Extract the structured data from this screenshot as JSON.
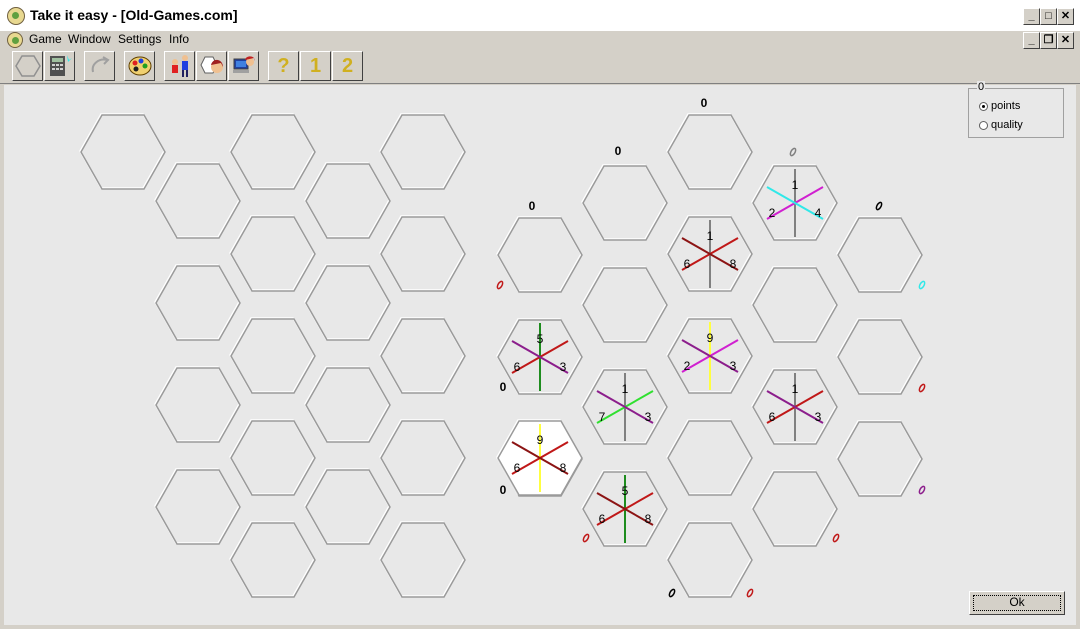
{
  "window": {
    "title": "Take it easy - [Old-Games.com]",
    "controls": [
      "_",
      "□",
      "✕"
    ],
    "mdi_controls": [
      "_",
      "❐",
      "✕"
    ]
  },
  "menu": {
    "items": [
      "Game",
      "Window",
      "Settings",
      "Info"
    ]
  },
  "toolbar": {
    "buttons": [
      {
        "name": "hexagon-button",
        "icon": "hexagon-icon",
        "enabled": false
      },
      {
        "name": "calculator-button",
        "icon": "calculator-icon",
        "enabled": true
      },
      {
        "name": "undo-button",
        "icon": "undo-arrow-icon",
        "enabled": false
      },
      {
        "name": "palette-button",
        "icon": "palette-icon",
        "enabled": true
      },
      {
        "name": "players-button",
        "icon": "players-icon",
        "enabled": true
      },
      {
        "name": "computer-player-button",
        "icon": "computer-player-icon",
        "enabled": true
      },
      {
        "name": "user-computer-button",
        "icon": "user-computer-icon",
        "enabled": true
      },
      {
        "name": "help-button",
        "icon": "question-star-icon",
        "label": "?"
      },
      {
        "name": "one-player-button",
        "icon": "number-star-icon",
        "label": "1"
      },
      {
        "name": "two-player-button",
        "icon": "number-star-icon",
        "label": "2"
      }
    ]
  },
  "colors": {
    "1": "#808080",
    "5": "#1e8c1e",
    "9": "#ffff40",
    "2": "#d020d0",
    "6": "#c01818",
    "7": "#30e030",
    "3": "#8c1e8c",
    "4": "#30e8e8",
    "8": "#8c1414",
    "hex_outline": "#9a9a9a",
    "board_bg": "#e8e8e8"
  },
  "score_panel": {
    "caption": "0",
    "options": [
      "points",
      "quality"
    ],
    "selected": "points"
  },
  "ok_label": "Ok",
  "column_scores": [
    {
      "label": "0"
    },
    {
      "label": "0"
    },
    {
      "label": "0"
    },
    {
      "label": "0"
    },
    {
      "label": "0"
    }
  ],
  "row_scores": [
    {
      "label": "0"
    },
    {
      "label": "0"
    }
  ],
  "placed_tiles": [
    {
      "pos": "c0r1",
      "v": 5,
      "l": 6,
      "r": 3
    },
    {
      "pos": "c1r2",
      "v": 1,
      "l": 7,
      "r": 3
    },
    {
      "pos": "c1r3",
      "v": 5,
      "l": 6,
      "r": 8
    },
    {
      "pos": "c2r1",
      "v": 1,
      "l": 6,
      "r": 8
    },
    {
      "pos": "c2r2",
      "v": 9,
      "l": 2,
      "r": 3
    },
    {
      "pos": "c3r0",
      "v": 1,
      "l": 2,
      "r": 4
    },
    {
      "pos": "c3r2",
      "v": 1,
      "l": 6,
      "r": 3
    }
  ],
  "next_tile": {
    "v": 9,
    "l": 6,
    "r": 8
  },
  "edge_markers": [
    {
      "color": "#c01818"
    },
    {
      "color": "#808080"
    },
    {
      "color": "#000000"
    },
    {
      "color": "#30e8e8"
    },
    {
      "color": "#c01818"
    },
    {
      "color": "#8c1e8c"
    },
    {
      "color": "#c01818"
    },
    {
      "color": "#c01818"
    },
    {
      "color": "#000000"
    },
    {
      "color": "#c01818"
    }
  ]
}
